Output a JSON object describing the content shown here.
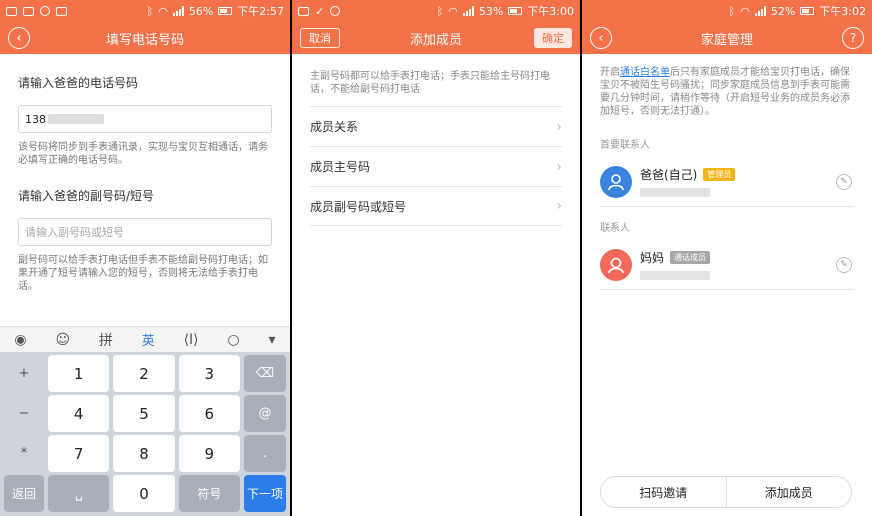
{
  "screen1": {
    "status": {
      "battery": "56%",
      "time": "下午2:57"
    },
    "title": "填写电话号码",
    "label_main": "请输入爸爸的电话号码",
    "main_value": "138",
    "main_hint": "该号码将同步到手表通讯录，实现与宝贝互相通话，请务必填写正确的电话号码。",
    "label_sub": "请输入爸爸的副号码/短号",
    "sub_placeholder": "请输入副号码或短号",
    "sub_hint": "副号码可以给手表打电话但手表不能给副号码打电话；如果开通了短号请输入您的短号，否则将无法给手表打电话。",
    "keyboard_tools": {
      "pinyin": "拼",
      "english": "英"
    },
    "keys": {
      "row1": [
        "+",
        "1",
        "2",
        "3"
      ],
      "row2": [
        "−",
        "4",
        "5",
        "6",
        "@"
      ],
      "row3": [
        "*",
        "7",
        "8",
        "9",
        "."
      ],
      "row4_side": "/",
      "back": "返回",
      "zero": "0",
      "symbol": "符号",
      "next": "下一项"
    }
  },
  "screen2": {
    "status": {
      "battery": "53%",
      "time": "下午3:00"
    },
    "title": "添加成员",
    "cancel": "取消",
    "confirm": "确定",
    "note": "主副号码都可以给手表打电话；手表只能给主号码打电话，不能给副号码打电话",
    "rows": [
      "成员关系",
      "成员主号码",
      "成员副号码或短号"
    ]
  },
  "screen3": {
    "status": {
      "battery": "52%",
      "time": "下午3:02"
    },
    "title": "家庭管理",
    "note_prefix": "开启",
    "note_link": "通话白名单",
    "note_rest": "后只有家庭成员才能给宝贝打电话，确保宝贝不被陌生号码骚扰；同步家庭成员信息到手表可能需要几分钟时间，请稍作等待（开启短号业务的成员务必添加短号，否则无法打通）。",
    "section_primary": "首要联系人",
    "section_contacts": "联系人",
    "contact1": {
      "name": "爸爸(自己)",
      "badge": "管理员"
    },
    "contact2": {
      "name": "妈妈",
      "badge": "通话成员"
    },
    "btn_scan": "扫码邀请",
    "btn_add": "添加成员"
  }
}
